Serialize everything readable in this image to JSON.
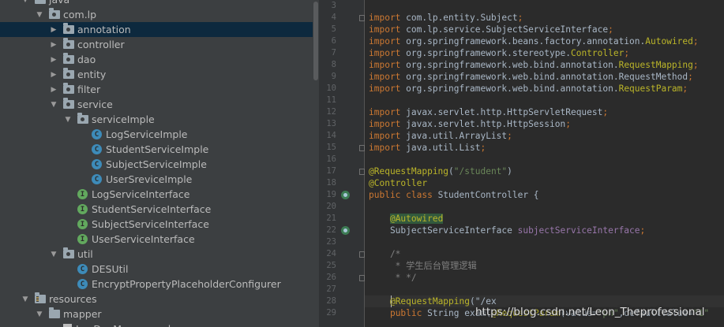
{
  "project_tree": {
    "items": [
      {
        "label": "java",
        "indent": 0,
        "arrow": "down",
        "icon": "source-folder-icon"
      },
      {
        "label": "com.lp",
        "indent": 1,
        "arrow": "down",
        "icon": "package-icon"
      },
      {
        "label": "annotation",
        "indent": 2,
        "arrow": "right",
        "icon": "package-icon",
        "selected": true
      },
      {
        "label": "controller",
        "indent": 2,
        "arrow": "right",
        "icon": "package-icon"
      },
      {
        "label": "dao",
        "indent": 2,
        "arrow": "right",
        "icon": "package-icon"
      },
      {
        "label": "entity",
        "indent": 2,
        "arrow": "right",
        "icon": "package-icon"
      },
      {
        "label": "filter",
        "indent": 2,
        "arrow": "right",
        "icon": "package-icon"
      },
      {
        "label": "service",
        "indent": 2,
        "arrow": "down",
        "icon": "package-icon"
      },
      {
        "label": "serviceImple",
        "indent": 3,
        "arrow": "down",
        "icon": "package-icon"
      },
      {
        "label": "LogServiceImple",
        "indent": 4,
        "arrow": "none",
        "icon": "class-icon"
      },
      {
        "label": "StudentServiceImple",
        "indent": 4,
        "arrow": "none",
        "icon": "class-icon"
      },
      {
        "label": "SubjectServiceImple",
        "indent": 4,
        "arrow": "none",
        "icon": "class-icon"
      },
      {
        "label": "UserSreviceImple",
        "indent": 4,
        "arrow": "none",
        "icon": "class-icon"
      },
      {
        "label": "LogServiceInterface",
        "indent": 3,
        "arrow": "none",
        "icon": "interface-icon"
      },
      {
        "label": "StudentServiceInterface",
        "indent": 3,
        "arrow": "none",
        "icon": "interface-icon"
      },
      {
        "label": "SubjectServiceInterface",
        "indent": 3,
        "arrow": "none",
        "icon": "interface-icon"
      },
      {
        "label": "UserServiceInterface",
        "indent": 3,
        "arrow": "none",
        "icon": "interface-icon"
      },
      {
        "label": "util",
        "indent": 2,
        "arrow": "down",
        "icon": "package-icon"
      },
      {
        "label": "DESUtil",
        "indent": 3,
        "arrow": "none",
        "icon": "class-icon"
      },
      {
        "label": "EncryptPropertyPlaceholderConfigurer",
        "indent": 3,
        "arrow": "none",
        "icon": "class-icon"
      },
      {
        "label": "resources",
        "indent": 0,
        "arrow": "down",
        "icon": "resources-folder-icon"
      },
      {
        "label": "mapper",
        "indent": 1,
        "arrow": "down",
        "icon": "folder-icon"
      },
      {
        "label": "LogDaoMapper.xml",
        "indent": 2,
        "arrow": "none",
        "icon": "xml-file-icon"
      }
    ]
  },
  "editor": {
    "lines": [
      {
        "n": "3",
        "tokens": []
      },
      {
        "n": "4",
        "tokens": [
          [
            "kw",
            "import "
          ],
          [
            "",
            "com.lp.entity.Subject"
          ],
          [
            "kw",
            ";"
          ]
        ],
        "fold": true
      },
      {
        "n": "5",
        "tokens": [
          [
            "kw",
            "import "
          ],
          [
            "",
            "com.lp.service.SubjectServiceInterface"
          ],
          [
            "kw",
            ";"
          ]
        ]
      },
      {
        "n": "6",
        "tokens": [
          [
            "kw",
            "import "
          ],
          [
            "",
            "org.springframework.beans.factory.annotation."
          ],
          [
            "ann",
            "Autowired"
          ],
          [
            "kw",
            ";"
          ]
        ]
      },
      {
        "n": "7",
        "tokens": [
          [
            "kw",
            "import "
          ],
          [
            "",
            "org.springframework.stereotype."
          ],
          [
            "ann",
            "Controller"
          ],
          [
            "kw",
            ";"
          ]
        ]
      },
      {
        "n": "8",
        "tokens": [
          [
            "kw",
            "import "
          ],
          [
            "",
            "org.springframework.web.bind.annotation."
          ],
          [
            "ann",
            "RequestMapping"
          ],
          [
            "kw",
            ";"
          ]
        ]
      },
      {
        "n": "9",
        "tokens": [
          [
            "kw",
            "import "
          ],
          [
            "",
            "org.springframework.web.bind.annotation.RequestMethod"
          ],
          [
            "kw",
            ";"
          ]
        ]
      },
      {
        "n": "10",
        "tokens": [
          [
            "kw",
            "import "
          ],
          [
            "",
            "org.springframework.web.bind.annotation."
          ],
          [
            "ann",
            "RequestParam"
          ],
          [
            "kw",
            ";"
          ]
        ]
      },
      {
        "n": "11",
        "tokens": []
      },
      {
        "n": "12",
        "tokens": [
          [
            "kw",
            "import "
          ],
          [
            "",
            "javax.servlet.http.HttpServletRequest"
          ],
          [
            "kw",
            ";"
          ]
        ]
      },
      {
        "n": "13",
        "tokens": [
          [
            "kw",
            "import "
          ],
          [
            "",
            "javax.servlet.http.HttpSession"
          ],
          [
            "kw",
            ";"
          ]
        ]
      },
      {
        "n": "14",
        "tokens": [
          [
            "kw",
            "import "
          ],
          [
            "",
            "java.util.ArrayList"
          ],
          [
            "kw",
            ";"
          ]
        ]
      },
      {
        "n": "15",
        "tokens": [
          [
            "kw",
            "import "
          ],
          [
            "",
            "java.util.List"
          ],
          [
            "kw",
            ";"
          ]
        ],
        "fold": true
      },
      {
        "n": "16",
        "tokens": []
      },
      {
        "n": "17",
        "tokens": [
          [
            "ann",
            "@RequestMapping"
          ],
          [
            "",
            "("
          ],
          [
            "str",
            "\"/student\""
          ],
          [
            "",
            ")"
          ]
        ],
        "fold": true
      },
      {
        "n": "18",
        "tokens": [
          [
            "ann",
            "@Controller"
          ]
        ]
      },
      {
        "n": "19",
        "tokens": [
          [
            "kw",
            "public class "
          ],
          [
            "",
            "StudentController {"
          ]
        ],
        "gutter_icon": true
      },
      {
        "n": "20",
        "tokens": []
      },
      {
        "n": "21",
        "tokens": [
          [
            "",
            "    "
          ],
          [
            "ann hl",
            "@Autowired"
          ]
        ]
      },
      {
        "n": "22",
        "tokens": [
          [
            "",
            "    SubjectServiceInterface "
          ],
          [
            "fld",
            "subjectServiceInterface"
          ],
          [
            "kw",
            ";"
          ]
        ],
        "gutter_icon": true
      },
      {
        "n": "23",
        "tokens": []
      },
      {
        "n": "24",
        "tokens": [
          [
            "cmt",
            "    /*"
          ]
        ],
        "fold": true
      },
      {
        "n": "25",
        "tokens": [
          [
            "cmt",
            "     * 学生后台管理逻辑"
          ]
        ]
      },
      {
        "n": "26",
        "tokens": [
          [
            "cmt",
            "     * */"
          ]
        ],
        "fold": true
      },
      {
        "n": "27",
        "tokens": []
      },
      {
        "n": "28",
        "tokens": [
          [
            "",
            "    "
          ],
          [
            "ann",
            "@RequestMapping"
          ],
          [
            "",
            "(\"/ex"
          ]
        ]
      },
      {
        "n": "29",
        "tokens": [
          [
            "",
            "    "
          ],
          [
            "kw",
            "public "
          ],
          [
            "",
            "String "
          ],
          [
            "",
            "exam"
          ],
          [
            "",
            "("
          ],
          [
            "ann",
            "@RequestParam"
          ],
          [
            "",
            "(value="
          ],
          [
            "str",
            "\"pn\""
          ],
          [
            "",
            ",defaultValue="
          ],
          [
            "str",
            "\"1\""
          ]
        ]
      }
    ]
  },
  "watermark": "https://blog.csdn.net/Leon_Theprofessional"
}
